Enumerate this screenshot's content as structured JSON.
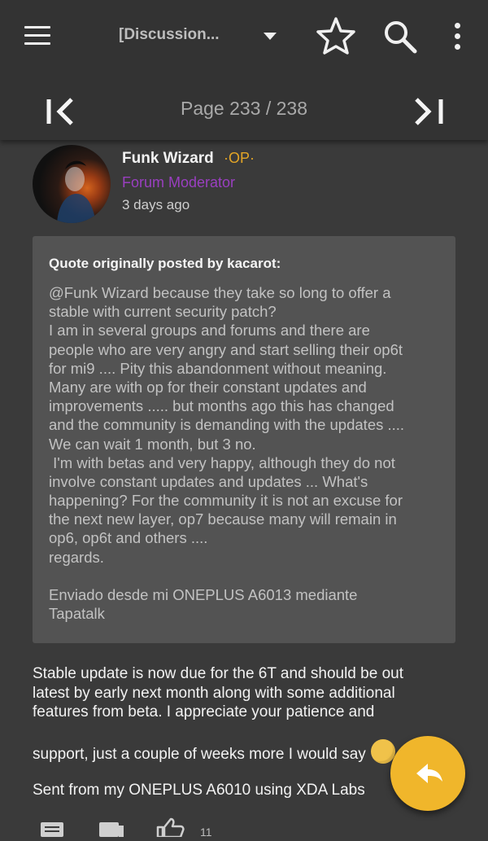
{
  "toolbar": {
    "thread_title": "[Discussion...",
    "icons": [
      "menu-icon",
      "chevron-down-icon",
      "star-icon",
      "search-icon",
      "more-vert-icon"
    ]
  },
  "pagination": {
    "label": "Page 233 / 238",
    "current_page": 233,
    "total_pages": 238
  },
  "post": {
    "author": "Funk Wizard",
    "op_badge": "·OP·",
    "author_title": "Forum Moderator",
    "time_ago": "3 days ago",
    "quote": {
      "header": "Quote originally posted by kacarot:",
      "lines": [
        "@Funk Wizard because they take so long to offer a",
        "stable with current security patch?",
        "I am in several groups and forums and there are",
        "people who are very angry and start selling their op6t",
        "for mi9 .... Pity this abandonment without meaning.",
        "Many are with op for their constant updates and",
        "improvements ..... but months ago this has changed",
        "and the community is demanding with the updates ....",
        "We can wait 1 month, but 3 no.",
        " I'm with betas and very happy, although they do not",
        "involve constant updates and updates ... What's",
        "happening? For the community it is not an excuse for",
        "the next new layer, op7 because many will remain in",
        "op6, op6t and others ....",
        "regards."
      ],
      "signature_lines": [
        "Enviado desde mi ONEPLUS A6013 mediante",
        "Tapatalk"
      ]
    },
    "body_lines": [
      "Stable update is now due for the 6T and should be out",
      "latest by early next month along with some additional",
      "features from beta. I appreciate your patience and"
    ],
    "body_line_2": "support, just a couple of weeks more I would say",
    "signature": "Sent from my ONEPLUS A6010 using XDA Labs",
    "like_count": "11"
  },
  "colors": {
    "background": "#3a3a3a",
    "toolbar": "#333333",
    "quote_box": "#535353",
    "op_badge": "#e3a526",
    "moderator_title": "#9a3fc0",
    "fab": "#f0b62b"
  }
}
